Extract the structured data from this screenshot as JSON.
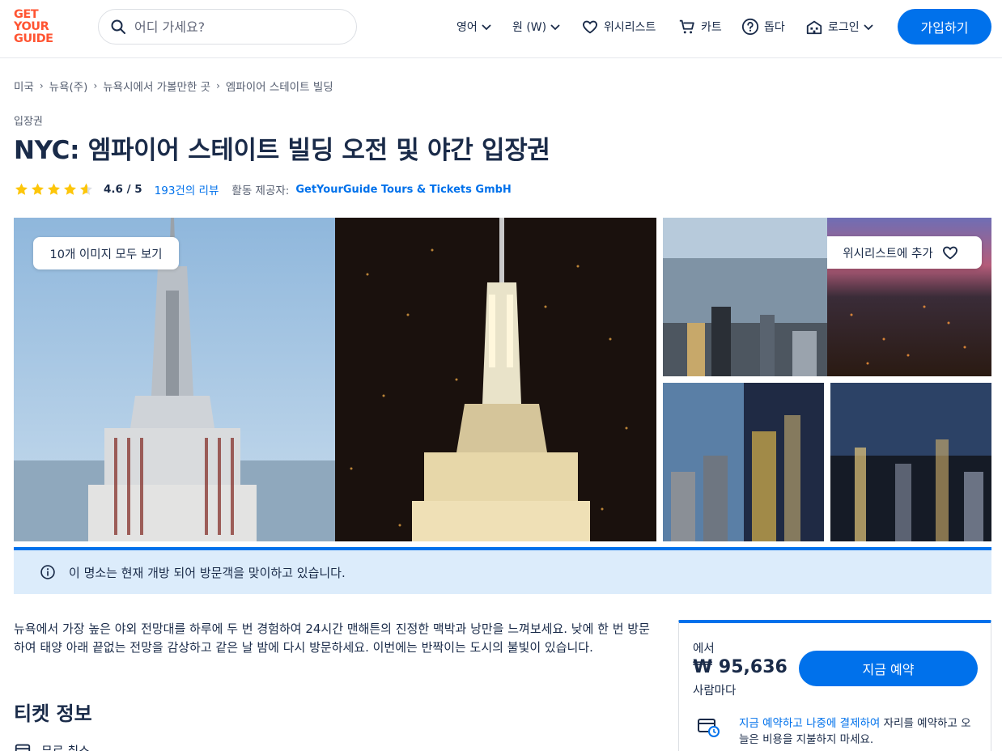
{
  "header": {
    "logo": [
      "GET",
      "YOUR",
      "GUIDE"
    ],
    "search_placeholder": "어디 가세요?",
    "language": "영어",
    "currency": "원 (W)",
    "wishlist": "위시리스트",
    "cart": "카트",
    "help": "돕다",
    "login": "로그인",
    "signup": "가입하기"
  },
  "breadcrumb": [
    "미국",
    "뉴욕(주)",
    "뉴욕시에서 가볼만한 곳",
    "엠파이어 스테이트 빌딩"
  ],
  "category": "입장권",
  "title": "NYC: 엠파이어 스테이트 빌딩 오전 및 야간 입장권",
  "rating": {
    "stars": 4.6,
    "score": "4.6 / 5",
    "reviews_count": "193",
    "reviews_suffix": "건의 리뷰",
    "provider_label": "활동 제공자:",
    "provider": "GetYourGuide Tours & Tickets GmbH"
  },
  "gallery": {
    "view_all": "10개 이미지 모두 보기",
    "add_wishlist": "위시리스트에 추가"
  },
  "notice": "이 명소는 현재 개방 되어 방문객을 맞이하고 있습니다.",
  "description": "뉴욕에서 가장 높은 야외 전망대를 하루에 두 번 경험하여 24시간 맨해튼의 진정한 맥박과 낭만을 느껴보세요. 낮에 한 번 방문하여 태양 아래 끝없는 전망을 감상하고 같은 날 밤에 다시 방문하세요. 이번에는 반짝이는 도시의 불빛이 있습니다.",
  "ticket_section": {
    "title": "티켓 정보",
    "first_item": "무료 취소"
  },
  "booking": {
    "from": "에서",
    "price": "₩ 95,636",
    "per": "사람마다",
    "button": "지금 예약",
    "paylater_link": "지금 예약하고 나중에 결제하여",
    "paylater_rest": " 자리를 예약하고 오늘은 비용을 지불하지 마세요."
  },
  "colors": {
    "brand": "#ff5533",
    "primary": "#0071eb",
    "text": "#1a2b49",
    "notice_bg": "#dcecfb",
    "star": "#fdc60a"
  }
}
